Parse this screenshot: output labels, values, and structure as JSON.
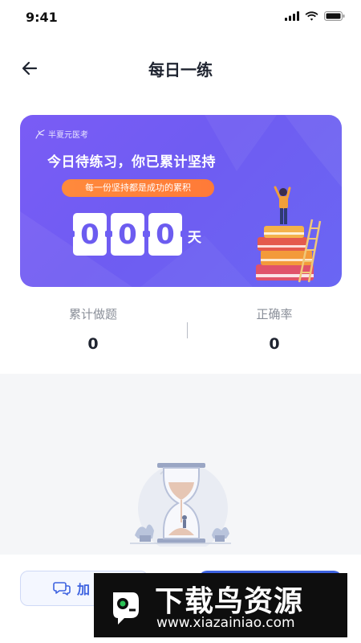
{
  "status_bar": {
    "time": "9:41",
    "icons": [
      "signal-icon",
      "wifi-icon",
      "battery-icon"
    ]
  },
  "nav": {
    "title": "每日一练",
    "back_icon": "arrow-left-icon"
  },
  "banner": {
    "brand": "半夏元医考",
    "title": "今日待练习，你已累计坚持",
    "motto": "每一份坚持都是成功的累积",
    "days_digits": [
      "0",
      "0",
      "0"
    ],
    "day_unit": "天",
    "accent_color": "#6c5cf0",
    "pill_color": "#ff8a3c"
  },
  "stats": {
    "total": {
      "label": "累计做题",
      "value": "0"
    },
    "accuracy": {
      "label": "正确率",
      "value": "0"
    }
  },
  "bottom": {
    "join_label": "加",
    "join_icon": "chat-bubbles-icon",
    "primary_color": "#3d62e0"
  },
  "watermark": {
    "name": "下载鸟资源",
    "url": "www.xiazainiao.com"
  }
}
